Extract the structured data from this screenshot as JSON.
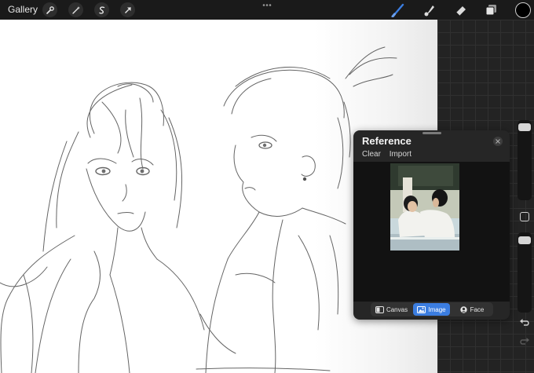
{
  "toolbar": {
    "gallery_label": "Gallery",
    "left_tools": [
      {
        "name": "wrench-icon"
      },
      {
        "name": "magic-wand-icon"
      },
      {
        "name": "selection-icon"
      },
      {
        "name": "transform-arrow-icon"
      }
    ],
    "right_tools": [
      {
        "name": "brush-icon",
        "active": true
      },
      {
        "name": "smudge-icon"
      },
      {
        "name": "eraser-icon"
      },
      {
        "name": "layers-icon"
      }
    ],
    "current_color": "#000000",
    "accent_color": "#3b7de0"
  },
  "sidebar": {
    "brush_size_level": 0.95,
    "opacity_level": 0.93,
    "modify_icon": "square-icon",
    "undo_icon": "undo-icon",
    "redo_icon": "redo-icon"
  },
  "reference": {
    "title": "Reference",
    "clear_label": "Clear",
    "import_label": "Import",
    "close_icon": "close-icon",
    "modes": [
      {
        "label": "Canvas",
        "icon": "canvas-icon",
        "active": false
      },
      {
        "label": "Image",
        "icon": "image-icon",
        "active": true
      },
      {
        "label": "Face",
        "icon": "face-icon",
        "active": false
      }
    ]
  }
}
